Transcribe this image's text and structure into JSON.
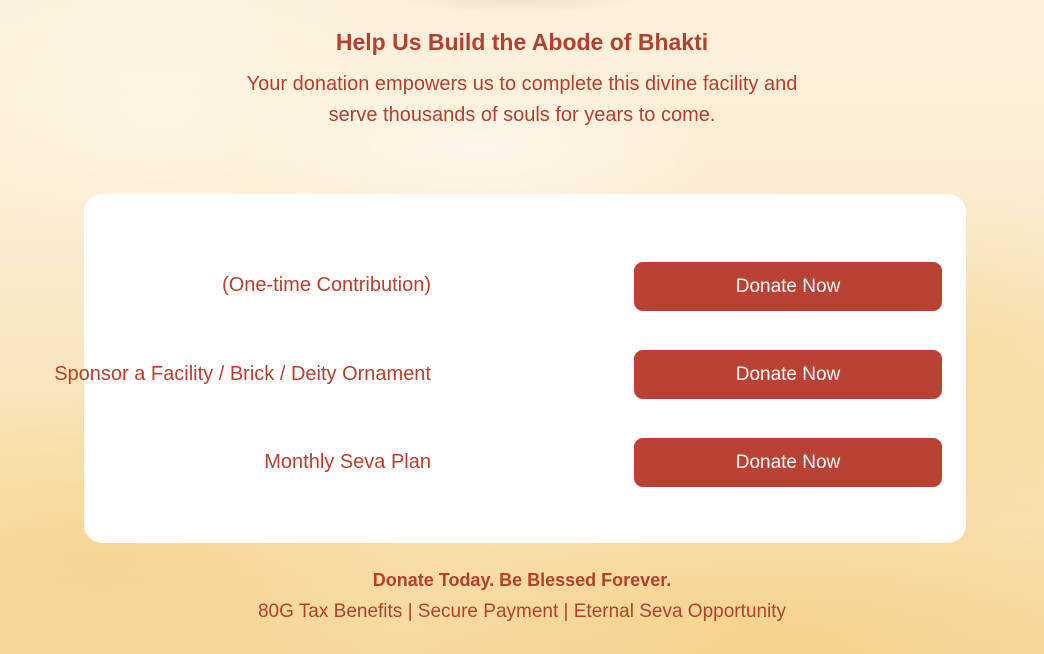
{
  "header": {
    "title": "Help Us Build the Abode of Bhakti",
    "subtitle_line1": "Your donation empowers us to complete this divine facility and",
    "subtitle_line2": "serve thousands of souls for years to come."
  },
  "donation_options": [
    {
      "label": "(One-time Contribution)",
      "button_label": "Donate Now"
    },
    {
      "label": "Sponsor a Facility / Brick / Deity Ornament",
      "button_label": "Donate Now"
    },
    {
      "label": "Monthly Seva Plan",
      "button_label": "Donate Now"
    }
  ],
  "footer": {
    "tagline": "Donate Today. Be Blessed Forever.",
    "benefits": "80G Tax Benefits | Secure Payment | Eternal Seva Opportunity"
  },
  "colors": {
    "accent": "#b5402f",
    "button_bg": "#b94234",
    "card_bg": "#ffffff"
  }
}
